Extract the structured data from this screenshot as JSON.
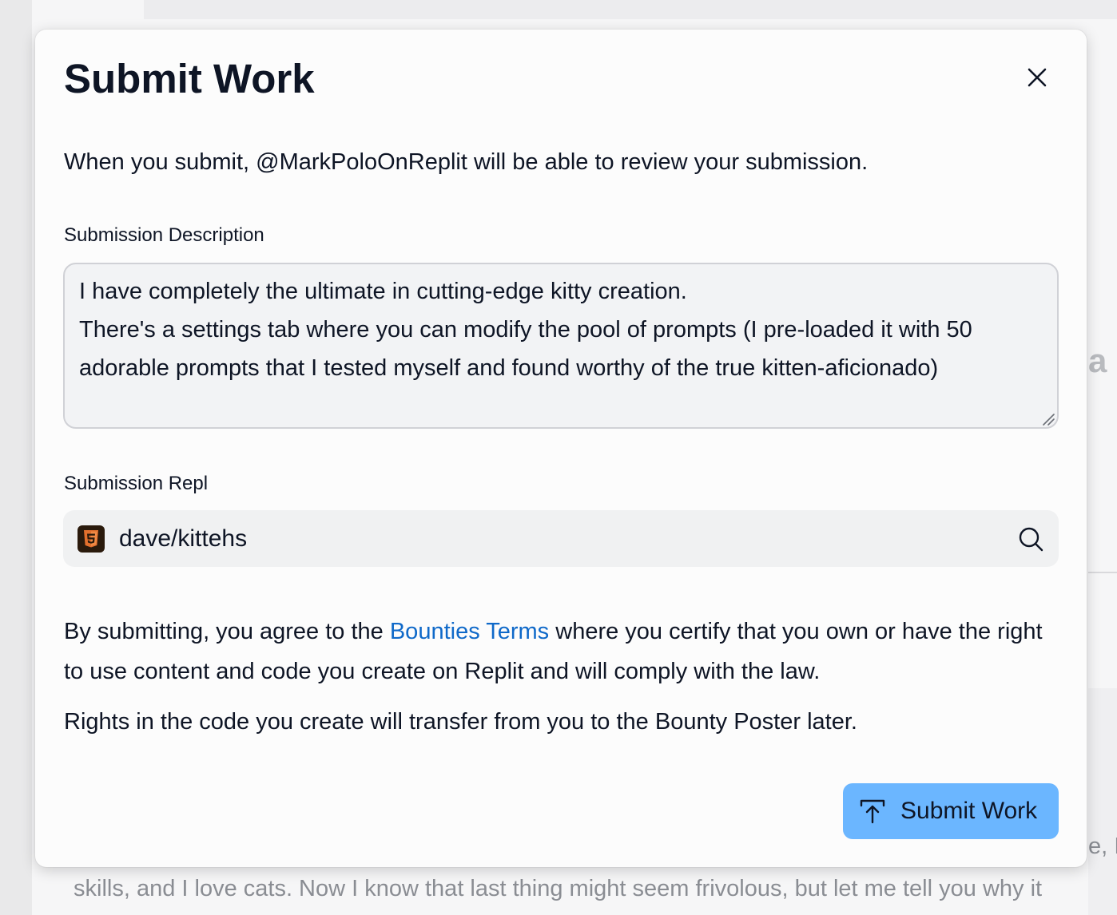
{
  "background": {
    "text_bottom": "skills, and I love cats. Now I know that last thing might seem frivolous, but let me tell you why it",
    "text_right_top": "a (",
    "text_right_mid": "e, I"
  },
  "modal": {
    "title": "Submit Work",
    "close_icon": "close-icon",
    "intro": "When you submit, @MarkPoloOnReplit will be able to review your submission.",
    "description_label": "Submission Description",
    "description_value": "I have completely the ultimate in cutting-edge kitty creation.\nThere's a settings tab where you can modify the pool of prompts (I pre-loaded it with 50 adorable prompts that I tested myself and found worthy of the true kitten-aficionado)",
    "repl_label": "Submission Repl",
    "repl_icon": "html5-icon",
    "repl_value": "dave/kittehs",
    "repl_search_icon": "search-icon",
    "terms_prefix": "By submitting, you agree to the ",
    "terms_link": "Bounties Terms",
    "terms_suffix": " where you certify that you own or have the right to use content and code you create on Replit and will comply with the law.",
    "rights": "Rights in the code you create will transfer from you to the Bounty Poster later.",
    "submit_label": "Submit Work",
    "submit_icon": "upload-icon"
  },
  "colors": {
    "accent_button": "#6bb6ff",
    "link": "#0f69c9",
    "text": "#0e1525",
    "html5_orange": "#e3702d"
  }
}
